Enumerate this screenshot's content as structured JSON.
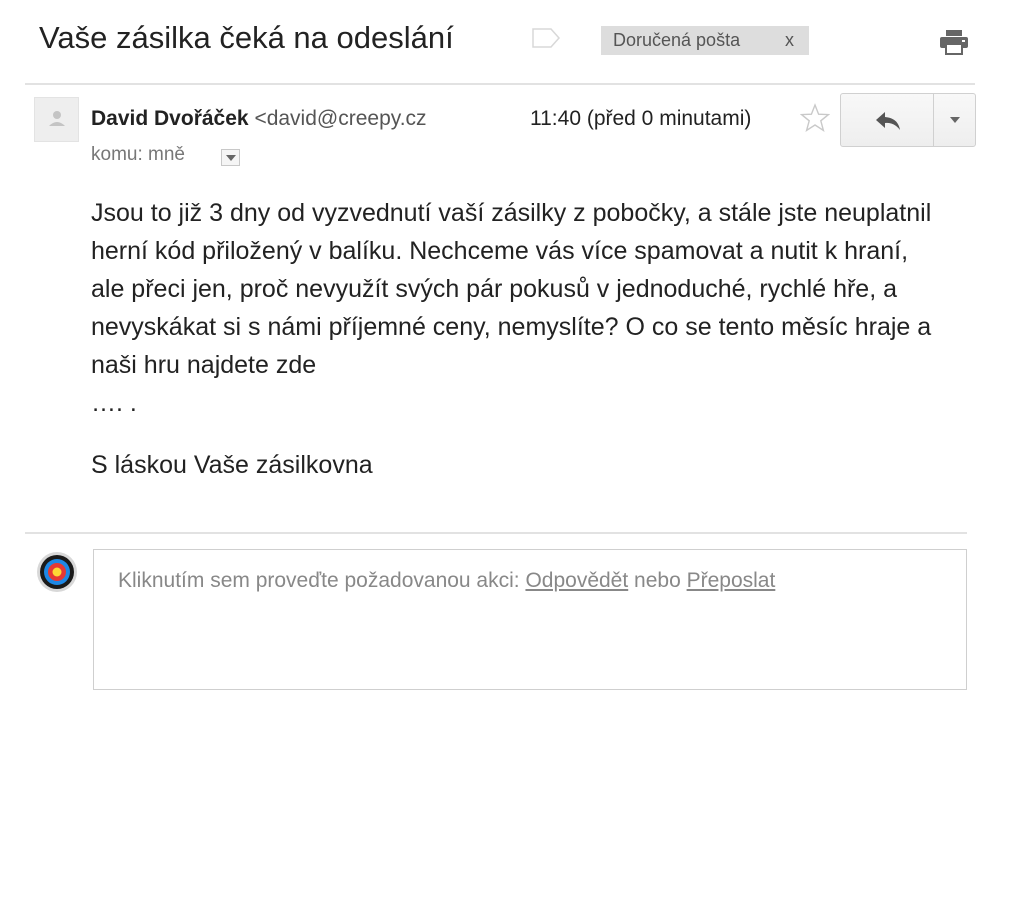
{
  "email": {
    "subject": "Vaše zásilka čeká na odeslání",
    "label": "Doručená pošta",
    "label_remove": "x",
    "sender_name": "David Dvořáček",
    "sender_email": "<david@creepy.cz",
    "time": "11:40 (před 0 minutami)",
    "to_line": "komu: mně",
    "body": "Jsou to již 3 dny od vyzvednutí vaší zásilky z pobočky, a stále jste neuplatnil herní kód přiložený v balíku. Nechceme vás více spamovat a nutit k hraní, ale přeci jen, proč nevyužít svých pár pokusů v jednoduché, rychlé hře, a nevyskákat si s námi příjemné ceny, nemyslíte? O co se tento měsíc hraje a naši hru najdete zde\n…. .",
    "signature": "S láskou Vaše zásilkovna"
  },
  "reply_box": {
    "prompt": "Kliknutím sem proveďte požadovanou akci: ",
    "reply_link": "Odpovědět",
    "or": " nebo ",
    "forward_link": "Přeposlat"
  },
  "icons": {
    "label": "label-outline-icon",
    "print": "printer-icon",
    "avatar": "person-icon",
    "star": "star-outline-icon",
    "reply": "reply-arrow-icon",
    "more": "caret-down-icon",
    "to_details": "caret-down-icon",
    "target": "target-icon"
  },
  "colors": {
    "label_chip_bg": "#dddddd",
    "separator": "#e2e2e2",
    "muted_text": "#888888",
    "target_red": "#e53935",
    "target_yellow": "#fdd835",
    "target_blue": "#1e88e5"
  }
}
